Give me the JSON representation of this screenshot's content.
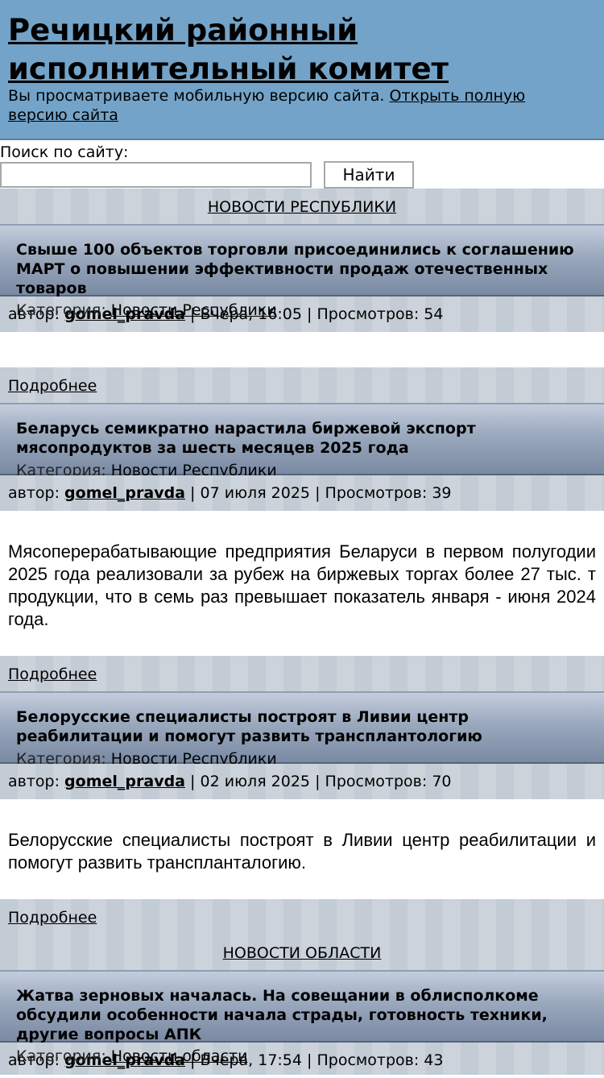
{
  "header": {
    "title": "Речицкий районный исполнительный комитет",
    "mobile_note": "Вы просматриваете мобильную версию сайта.",
    "full_version_link": "Открыть полную версию сайта"
  },
  "search": {
    "label": "Поиск по сайту:",
    "value": "",
    "button": "Найти"
  },
  "sections": [
    {
      "title": "НОВОСТИ РЕСПУБЛИКИ",
      "items": [
        {
          "title": "Свыше 100 объектов торговли присоединились к соглашению МАРТ о повышении эффективности продаж отечественных товаров",
          "category_label": "Категория:",
          "category": "Новости Республики",
          "author_label": "автор:",
          "author": "gomel_pravda",
          "date": "Вчера, 16:05",
          "views_label": "Просмотров:",
          "views": "54",
          "excerpt": "",
          "more": "Подробнее"
        },
        {
          "title": "Беларусь семикратно нарастила биржевой экспорт мясопродуктов за шесть месяцев 2025 года",
          "category_label": "Категория:",
          "category": "Новости Республики",
          "author_label": "автор:",
          "author": "gomel_pravda",
          "date": "07 июля 2025",
          "views_label": "Просмотров:",
          "views": "39",
          "excerpt": "Мясоперерабатывающие предприятия Беларуси в первом полугодии 2025 года реализовали за рубеж на биржевых торгах более 27 тыс. т продукции, что в семь раз превышает показатель января - июня 2024 года.",
          "more": "Подробнее"
        },
        {
          "title": "Белорусские специалисты построят в Ливии центр реабилитации и помогут развить трансплантологию",
          "category_label": "Категория:",
          "category": "Новости Республики",
          "author_label": "автор:",
          "author": "gomel_pravda",
          "date": "02 июля 2025",
          "views_label": "Просмотров:",
          "views": "70",
          "excerpt": "Белорусские специалисты построят в Ливии центр реабилитации и помогут развить трансплантaлогию.",
          "more": "Подробнее"
        }
      ]
    },
    {
      "title": "НОВОСТИ ОБЛАСТИ",
      "items": [
        {
          "title": "Жатва зерновых началась. На совещании в облисполкоме обсудили особенности начала страды, готовность техники, другие вопросы АПК",
          "category_label": "Категория:",
          "category": "Новости области",
          "author_label": "автор:",
          "author": "gomel_pravda",
          "date": "Вчера, 17:54",
          "views_label": "Просмотров:",
          "views": "43"
        }
      ]
    }
  ]
}
